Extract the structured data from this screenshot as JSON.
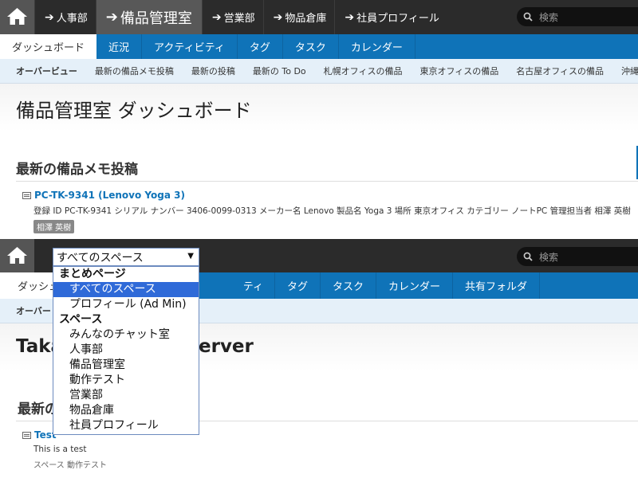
{
  "top": {
    "spaces": [
      {
        "label": "人事部"
      },
      {
        "label": "備品管理室",
        "current": true
      },
      {
        "label": "営業部"
      },
      {
        "label": "物品倉庫"
      },
      {
        "label": "社員プロフィール"
      }
    ],
    "search_placeholder": "検索",
    "tabs": [
      "ダッシュボード",
      "近況",
      "アクティビティ",
      "タグ",
      "タスク",
      "カレンダー"
    ],
    "subnav": [
      "オーバービュー",
      "最新の備品メモ投稿",
      "最新の投稿",
      "最新の To Do",
      "札幌オフィスの備品",
      "東京オフィスの備品",
      "名古屋オフィスの備品",
      "沖縄"
    ],
    "page_title": "備品管理室 ダッシュボード",
    "section_title": "最新の備品メモ投稿",
    "item": {
      "title": "PC-TK-9341 (Lenovo Yoga 3)",
      "desc": "登録 ID PC-TK-9341 シリアル ナンバー 3406-0099-0313 メーカー名 Lenovo 製品名 Yoga 3 場所 東京オフィス カテゴリー ノートPC 管理担当者 相澤 英樹",
      "tag": "相澤 英樹"
    }
  },
  "bottom": {
    "search_placeholder": "検索",
    "select_value": "すべてのスペース",
    "dropdown": [
      {
        "label": "まとめページ",
        "group": true
      },
      {
        "label": "すべてのスペース",
        "selected": true
      },
      {
        "label": "プロフィール (Ad Min)"
      },
      {
        "label": "スペース",
        "group": true
      },
      {
        "label": "みんなのチャット室"
      },
      {
        "label": "人事部"
      },
      {
        "label": "備品管理室"
      },
      {
        "label": "動作テスト"
      },
      {
        "label": "営業部"
      },
      {
        "label": "物品倉庫"
      },
      {
        "label": "社員プロフィール"
      }
    ],
    "tabs": [
      "ダッシュ",
      "ティ",
      "タグ",
      "タスク",
      "カレンダー",
      "共有フォルダ"
    ],
    "subnav_first": "オーバー",
    "page_title_left": "Taka",
    "page_title_right": "erver",
    "section_title": "最新の",
    "item": {
      "title": "Test",
      "desc": "This is a test",
      "meta": "スペース 動作テスト"
    }
  },
  "colors": {
    "accent": "#0f73b8",
    "topbar": "#2b2b2b",
    "subnav": "#e5f0f9",
    "selected": "#2f6ad8"
  }
}
